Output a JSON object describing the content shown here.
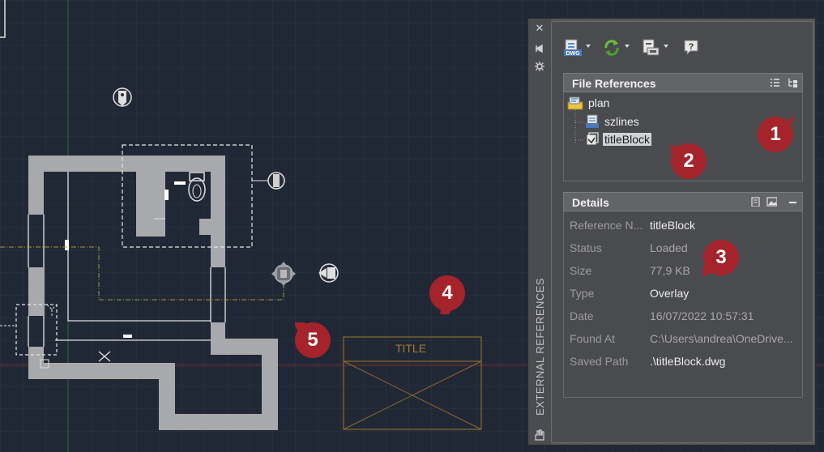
{
  "canvas": {
    "title_block_label": "TITLE"
  },
  "palette": {
    "vertical_title": "EXTERNAL REFERENCES",
    "toolbar": {
      "attach_dwg_icon": "attach-dwg-icon",
      "refresh_icon": "refresh-icon",
      "change_path_icon": "change-path-icon",
      "help_icon": "help-icon",
      "attach_badge": "DWG"
    },
    "file_references": {
      "header": "File References",
      "tree": [
        {
          "label": "plan",
          "level": 0,
          "icon": "drawing-root-icon"
        },
        {
          "label": "szlines",
          "level": 1,
          "icon": "dwg-file-icon"
        },
        {
          "label": "titleBlock",
          "level": 1,
          "icon": "xref-overlay-icon",
          "selected": true
        }
      ]
    },
    "details": {
      "header": "Details",
      "rows": [
        {
          "key": "Reference N...",
          "value": "titleBlock"
        },
        {
          "key": "Status",
          "value": "Loaded"
        },
        {
          "key": "Size",
          "value": "77,9 KB"
        },
        {
          "key": "Type",
          "value": "Overlay"
        },
        {
          "key": "Date",
          "value": "16/07/2022 10:57:31"
        },
        {
          "key": "Found At",
          "value": "C:\\Users\\andrea\\OneDrive..."
        },
        {
          "key": "Saved Path",
          "value": ".\\titleBlock.dwg"
        }
      ]
    }
  },
  "callouts": [
    "1",
    "2",
    "3",
    "4",
    "5"
  ],
  "colors": {
    "canvas_bg": "#212835",
    "marker_red": "#a5232a",
    "titleblock": "#8a6a2e",
    "wall": "#a7a9ac"
  }
}
